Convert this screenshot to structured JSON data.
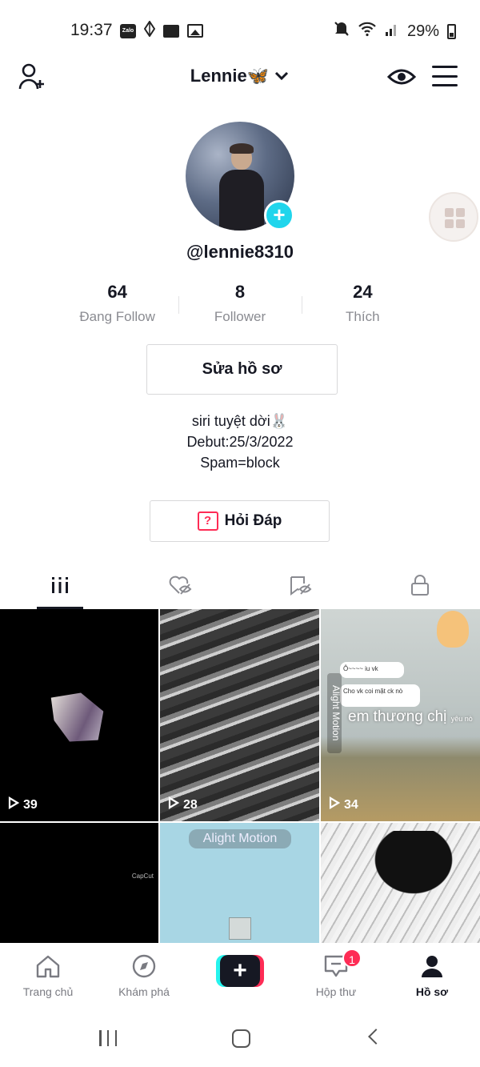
{
  "status_bar": {
    "time": "19:37",
    "app_icons": [
      "zalo-icon",
      "diamond-icon",
      "folder-icon",
      "gallery-icon"
    ],
    "zalo_label": "Zalo",
    "battery": "29%",
    "right_icons": [
      "mute-icon",
      "wifi-icon",
      "signal-icon",
      "battery-icon"
    ]
  },
  "header": {
    "title": "Lennie🦋",
    "icons": [
      "add-user-icon",
      "chevron-down-icon",
      "eye-icon",
      "menu-icon"
    ]
  },
  "profile": {
    "username": "@lennie8310",
    "stats": [
      {
        "value": "64",
        "label": "Đang Follow"
      },
      {
        "value": "8",
        "label": "Follower"
      },
      {
        "value": "24",
        "label": "Thích"
      }
    ],
    "edit_button": "Sửa hồ sơ",
    "bio": [
      "siri tuyệt dời🐰",
      "Debut:25/3/2022",
      "Spam=block"
    ],
    "qa_button": "Hỏi Đáp",
    "qa_icon_glyph": "?"
  },
  "tabs": [
    {
      "icon": "videos-grid-icon",
      "active": true
    },
    {
      "icon": "liked-hidden-icon",
      "active": false
    },
    {
      "icon": "favorites-hidden-icon",
      "active": false
    },
    {
      "icon": "lock-icon",
      "active": false
    }
  ],
  "videos": [
    {
      "views": "39"
    },
    {
      "views": "28"
    },
    {
      "views": "34",
      "chat_line_1": "Ô~~~~ iu vk",
      "chat_line_2": "Cho vk coi mặt ck nò",
      "caption": "em thương chị",
      "caption_tail": "yêu nò",
      "watermark": "Alight Motion"
    },
    {
      "views": "",
      "watermark": "CapCut"
    },
    {
      "views": "",
      "watermark": "Alight Motion"
    },
    {
      "views": ""
    }
  ],
  "bottom_nav": [
    {
      "label": "Trang chủ",
      "icon": "home-icon"
    },
    {
      "label": "Khám phá",
      "icon": "compass-icon"
    },
    {
      "label": "",
      "icon": "create-plus-icon",
      "glyph": "+"
    },
    {
      "label": "Hộp thư",
      "icon": "inbox-icon",
      "badge": "1"
    },
    {
      "label": "Hồ sơ",
      "icon": "profile-icon",
      "active": true
    }
  ],
  "colors": {
    "accent_red": "#fe2c55",
    "accent_cyan": "#25f4ee",
    "follow_plus": "#20d5ec",
    "text_primary": "#161823",
    "text_secondary": "#8a8b91"
  }
}
